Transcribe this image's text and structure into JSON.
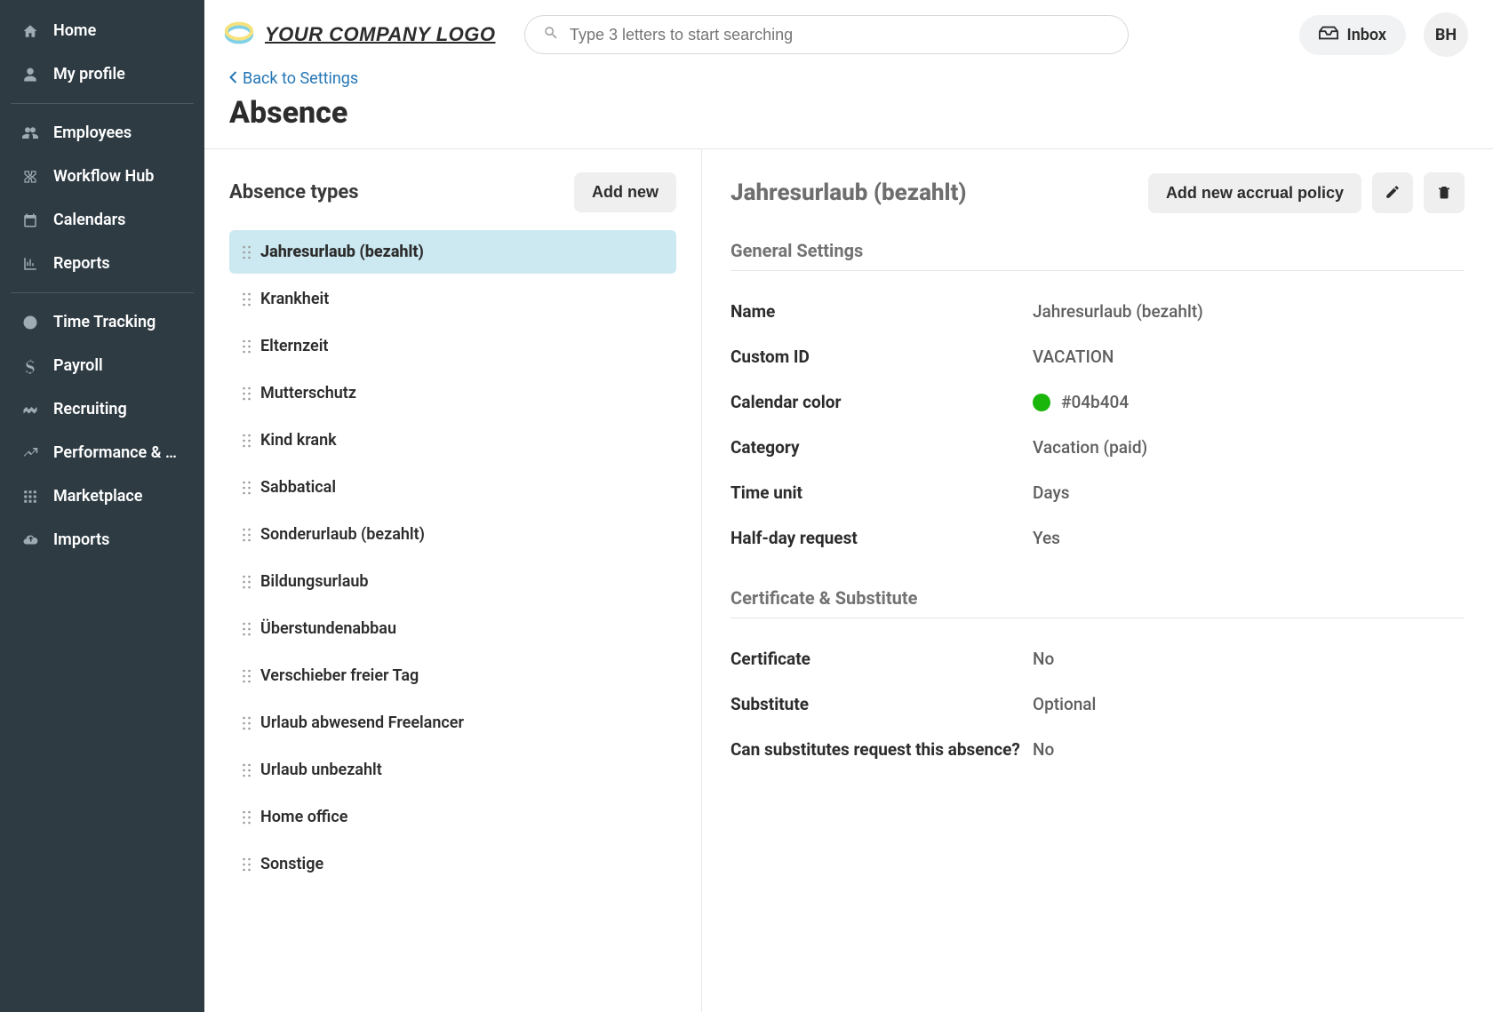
{
  "sidebar": {
    "items": [
      {
        "label": "Home",
        "icon": "home"
      },
      {
        "label": "My profile",
        "icon": "user"
      }
    ],
    "items2": [
      {
        "label": "Employees",
        "icon": "users"
      },
      {
        "label": "Workflow Hub",
        "icon": "workflow"
      },
      {
        "label": "Calendars",
        "icon": "calendar"
      },
      {
        "label": "Reports",
        "icon": "chart"
      }
    ],
    "items3": [
      {
        "label": "Time Tracking",
        "icon": "clock"
      },
      {
        "label": "Payroll",
        "icon": "dollar"
      },
      {
        "label": "Recruiting",
        "icon": "handshake"
      },
      {
        "label": "Performance & D...",
        "icon": "trend"
      },
      {
        "label": "Marketplace",
        "icon": "grid"
      },
      {
        "label": "Imports",
        "icon": "cloud"
      }
    ]
  },
  "header": {
    "logo_text": "YOUR COMPANY LOGO",
    "search_placeholder": "Type 3 letters to start searching",
    "inbox_label": "Inbox",
    "avatar_initials": "BH"
  },
  "breadcrumb": {
    "back_label": "Back to Settings"
  },
  "page": {
    "title": "Absence"
  },
  "absence_types": {
    "title": "Absence types",
    "add_button": "Add new",
    "items": [
      "Jahresurlaub (bezahlt)",
      "Krankheit",
      "Elternzeit",
      "Mutterschutz",
      "Kind krank",
      "Sabbatical",
      "Sonderurlaub (bezahlt)",
      "Bildungsurlaub",
      "Überstundenabbau",
      "Verschieber freier Tag",
      "Urlaub abwesend Freelancer",
      "Urlaub unbezahlt",
      "Home office",
      "Sonstige"
    ],
    "selected_index": 0
  },
  "detail": {
    "title": "Jahresurlaub (bezahlt)",
    "add_policy_button": "Add new accrual policy",
    "sections": {
      "general": {
        "title": "General Settings",
        "fields": {
          "name": {
            "label": "Name",
            "value": "Jahresurlaub (bezahlt)"
          },
          "custom_id": {
            "label": "Custom ID",
            "value": "VACATION"
          },
          "calendar_color": {
            "label": "Calendar color",
            "value": "#04b404",
            "swatch": "#1ab60b"
          },
          "category": {
            "label": "Category",
            "value": "Vacation (paid)"
          },
          "time_unit": {
            "label": "Time unit",
            "value": "Days"
          },
          "half_day": {
            "label": "Half-day request",
            "value": "Yes"
          }
        }
      },
      "certificate": {
        "title": "Certificate & Substitute",
        "fields": {
          "certificate": {
            "label": "Certificate",
            "value": "No"
          },
          "substitute": {
            "label": "Substitute",
            "value": "Optional"
          },
          "can_substitutes": {
            "label": "Can substitutes request this absence?",
            "value": "No"
          }
        }
      }
    }
  }
}
